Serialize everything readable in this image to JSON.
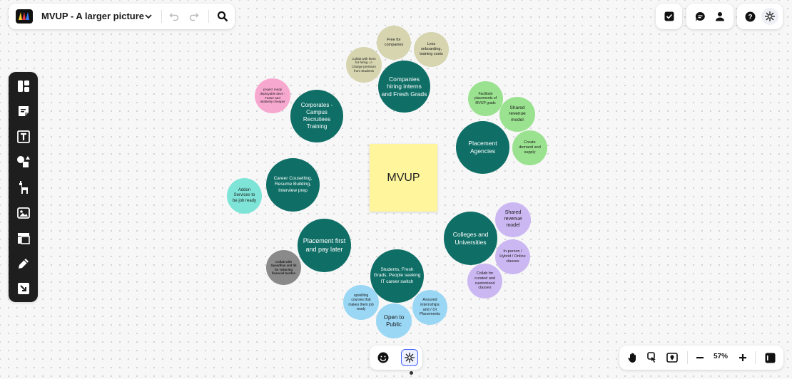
{
  "header": {
    "board_title": "MVUP - A larger picture"
  },
  "zoom": {
    "level": "57%"
  },
  "sticky_note": {
    "text": "MVUP"
  },
  "main_nodes": [
    {
      "text": "Companies hiring interns and Fresh Grads",
      "color": "#0f6f67"
    },
    {
      "text": "Corporates - Campus Recruitees Training",
      "color": "#0f6f67"
    },
    {
      "text": "Placement Agencies",
      "color": "#0f6f67"
    },
    {
      "text": "Career Couselling, Resume Building, Interview prep",
      "color": "#0f6f67"
    },
    {
      "text": "Colleges and Universities",
      "color": "#0f6f67"
    },
    {
      "text": "Placement first and pay later",
      "color": "#0f6f67"
    },
    {
      "text": "Students, Fresh Grads, People seeking IT career switch",
      "color": "#0f6f67"
    }
  ],
  "sub_nodes": [
    {
      "text": "Free for companies",
      "color": "#d6d5b0"
    },
    {
      "text": "Less onboarding, training costs",
      "color": "#d6d5b0"
    },
    {
      "text": "Collab with them for hiring => Charge premium from Students",
      "color": "#d6d5b0"
    },
    {
      "text": "project ready deployable devs - Faster and relatively cheaper",
      "color": "#f7a8cf"
    },
    {
      "text": "Facilitate placements of MVUP grads",
      "color": "#9ae28f"
    },
    {
      "text": "Shared revenue model",
      "color": "#9ae28f"
    },
    {
      "text": "Create demand and supply",
      "color": "#9ae28f"
    },
    {
      "text": "Addon Services to be job ready",
      "color": "#7fe4d8"
    },
    {
      "text": "Shared revenue model",
      "color": "#cbb8f2"
    },
    {
      "text": "In-person / Hybrid / Online classes",
      "color": "#cbb8f2"
    },
    {
      "text": "Collab for curated and customized classes",
      "color": "#cbb8f2"
    },
    {
      "text": "Collab with Gyandhan and lib for reducing financial burden",
      "color": "#8a8a8a"
    },
    {
      "text": "upskilling courses that makes them job ready",
      "color": "#9ad7f5"
    },
    {
      "text": "Assured internships and / Or Placements",
      "color": "#9ad7f5"
    },
    {
      "text": "Open to Public",
      "color": "#9ad7f5"
    }
  ]
}
